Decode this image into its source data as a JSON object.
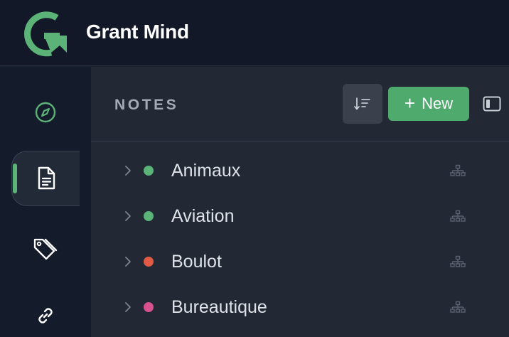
{
  "app": {
    "title": "Grant Mind"
  },
  "colors": {
    "accent": "#4faa6d",
    "header_bg": "#121828",
    "rail_bg": "#141b2b",
    "panel_bg": "#222935"
  },
  "rail": {
    "items": [
      {
        "icon": "compass-icon",
        "active": false
      },
      {
        "icon": "document-icon",
        "active": true
      },
      {
        "icon": "tags-icon",
        "active": false
      },
      {
        "icon": "link-icon",
        "active": false
      }
    ]
  },
  "notes": {
    "title": "NOTES",
    "sort_icon": "sort-icon",
    "new_label": "New",
    "panel_icon": "sidebar-toggle-icon",
    "items": [
      {
        "label": "Animaux",
        "color": "#5cb377"
      },
      {
        "label": "Aviation",
        "color": "#5cb377"
      },
      {
        "label": "Boulot",
        "color": "#e05a45"
      },
      {
        "label": "Bureautique",
        "color": "#d9508f"
      }
    ]
  }
}
